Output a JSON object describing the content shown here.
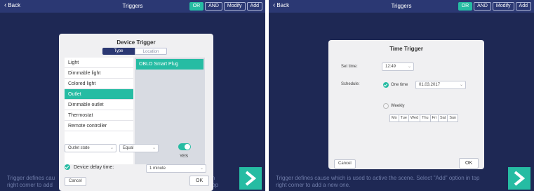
{
  "left_screen": {
    "back_label": "Back",
    "title": "Triggers",
    "top_buttons": [
      "OR",
      "AND",
      "Modify",
      "Add"
    ],
    "footer_text_line1": "Trigger defines cau",
    "footer_text_line1_tail": "in top",
    "footer_text_line2": "right corner to add",
    "device_trigger": {
      "title": "Device Trigger",
      "tabs": [
        "Type",
        "Location"
      ],
      "types": [
        "Light",
        "Dimmable light",
        "Colored light",
        "Outlet",
        "Dimmable outlet",
        "Thermostat",
        "Remote controller"
      ],
      "selected_type": "Outlet",
      "devices": [
        "OBLO Smart Plug"
      ],
      "condition_field": "Outlet state",
      "operator": "Equal",
      "value_label": "YES",
      "delay_label": "Device delay time:",
      "delay_value": "1 minute",
      "cancel_label": "Cancel",
      "ok_label": "OK"
    }
  },
  "right_screen": {
    "back_label": "Back",
    "title": "Triggers",
    "top_buttons": [
      "OR",
      "AND",
      "Modify",
      "Add"
    ],
    "footer_text_line1": "Trigger defines cause which is used to active the scene. Select \"Add\" option in top",
    "footer_text_line2": "right corner to add a new one.",
    "time_trigger": {
      "title": "Time Trigger",
      "set_time_label": "Set time:",
      "time_value": "12:49",
      "schedule_label": "Schedule:",
      "one_time_label": "One time",
      "date_value": "01.03.2017",
      "weekly_label": "Weekly",
      "days": [
        "Mo",
        "Tue",
        "Wed",
        "Thu",
        "Fri",
        "Sat",
        "Sun"
      ],
      "cancel_label": "Cancel",
      "ok_label": "OK"
    }
  },
  "colors": {
    "accent": "#26bca3",
    "nav_bg": "#2b3873",
    "overlay_bg": "#1e2854"
  }
}
